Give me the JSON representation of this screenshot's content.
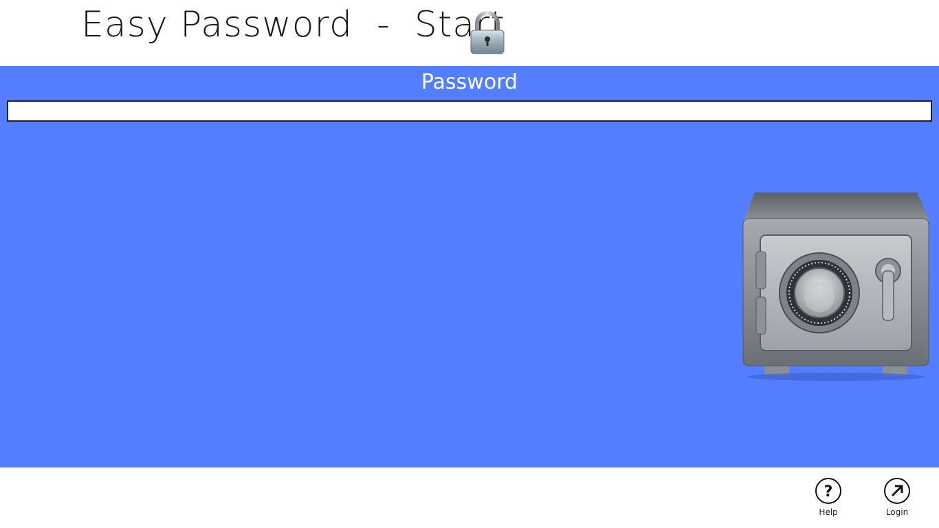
{
  "header": {
    "title": "Easy Password  -  Start",
    "icon": "padlock-icon"
  },
  "main": {
    "background": "#537eff",
    "password_label": "Password",
    "password_value": "",
    "password_placeholder": "",
    "image": "safe-icon"
  },
  "appbar": {
    "buttons": [
      {
        "label": "Help",
        "icon": "question-mark-icon"
      },
      {
        "label": "Login",
        "icon": "arrow-up-right-icon"
      }
    ]
  }
}
